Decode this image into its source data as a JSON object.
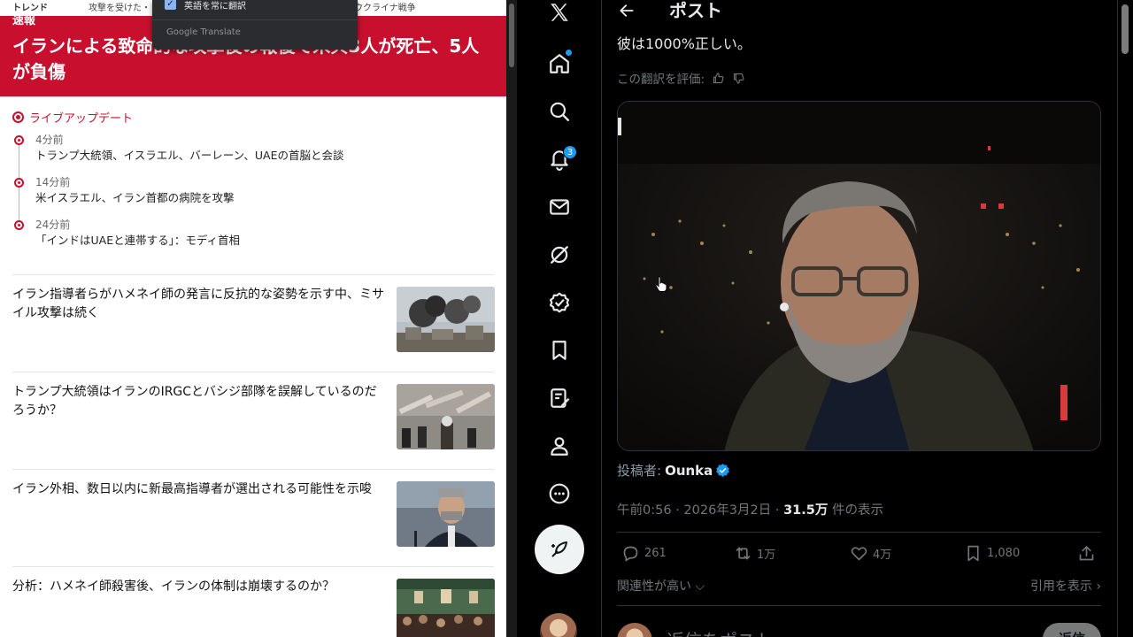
{
  "news": {
    "trend_label": "トレンド",
    "trend_text": "攻撃を受けた・・・・・・・・・・・・・・・・・・・・・・・・ウクライナ戦争",
    "breaking_tag": "速報",
    "breaking_headline": "イランによる致命的な攻撃後の報復で米兵3人が死亡、5人が負傷",
    "live_label": "ライブアップデート",
    "live_updates": [
      {
        "time": "4分前",
        "text": "トランプ大統領、イスラエル、バーレーン、UAEの首脳と会談"
      },
      {
        "time": "14分前",
        "text": "米イスラエル、イラン首都の病院を攻撃"
      },
      {
        "time": "24分前",
        "text": "「インドはUAEと連帯する」：モディ首相"
      }
    ],
    "articles": [
      {
        "title": "イラン指導者らがハメネイ師の発言に反抗的な姿勢を示す中、ミサイル攻撃は続く"
      },
      {
        "title": "トランプ大統領はイランのIRGCとバシジ部隊を誤解しているのだろうか？"
      },
      {
        "title": "イラン外相、数日以内に新最高指導者が選出される可能性を示唆"
      },
      {
        "title": "分析：ハメネイ師殺害後、イランの体制は崩壊するのか？"
      }
    ],
    "translate_popup": {
      "option_label": "英語を常に翻訳",
      "brand": "Google Translate"
    }
  },
  "x": {
    "notifications_badge": "3",
    "page_title": "ポスト",
    "post_text": "彼は1000%正しい。",
    "rate_label": "この翻訳を評価:",
    "author_prefix": "投稿者:",
    "author_name": "Ounka",
    "meta_time": "午前0:56 · 2026年3月2日 · ",
    "meta_views": "31.5万",
    "meta_views_suffix": " 件の表示",
    "actions": {
      "replies": "261",
      "reposts": "1万",
      "likes": "4万",
      "bookmarks": "1,080"
    },
    "relevance_label": "関連性が高い",
    "quotes_label": "引用を表示",
    "reply_placeholder": "返信をポスト",
    "reply_button": "返信"
  },
  "colors": {
    "breaking_red": "#c8102e",
    "x_blue": "#1d9bf0"
  }
}
